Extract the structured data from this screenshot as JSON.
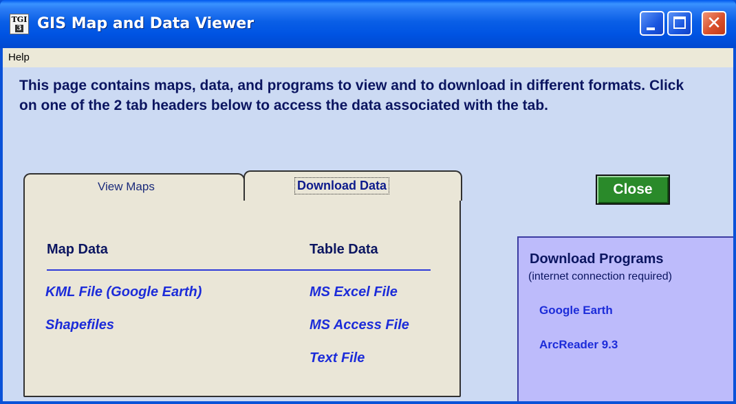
{
  "window": {
    "title": "GIS Map and Data Viewer",
    "icon_top": "TGI",
    "icon_num": "3"
  },
  "menu": {
    "help": "Help"
  },
  "intro": "This page contains maps, data, and programs to view and to download in different formats.  Click on one of the 2 tab headers below to access the data associated with the tab.",
  "tabs": [
    {
      "label": "View Maps",
      "active": false
    },
    {
      "label": "Download Data",
      "active": true
    }
  ],
  "download_tab": {
    "map_header": "Map Data",
    "table_header": "Table Data",
    "map_links": [
      "KML File (Google Earth)",
      "Shapefiles"
    ],
    "table_links": [
      "MS Excel File",
      "MS Access File",
      "Text File"
    ]
  },
  "close_label": "Close",
  "programs": {
    "title": "Download Programs",
    "subtitle": "(internet connection required)",
    "links": [
      "Google Earth",
      "ArcReader 9.3"
    ]
  },
  "colors": {
    "titlebar": "#0054e3",
    "client_bg": "#ccdaf3",
    "link": "#1c2cd9",
    "close_button": "#2a8a2a",
    "programs_panel": "#bdbbfb"
  }
}
